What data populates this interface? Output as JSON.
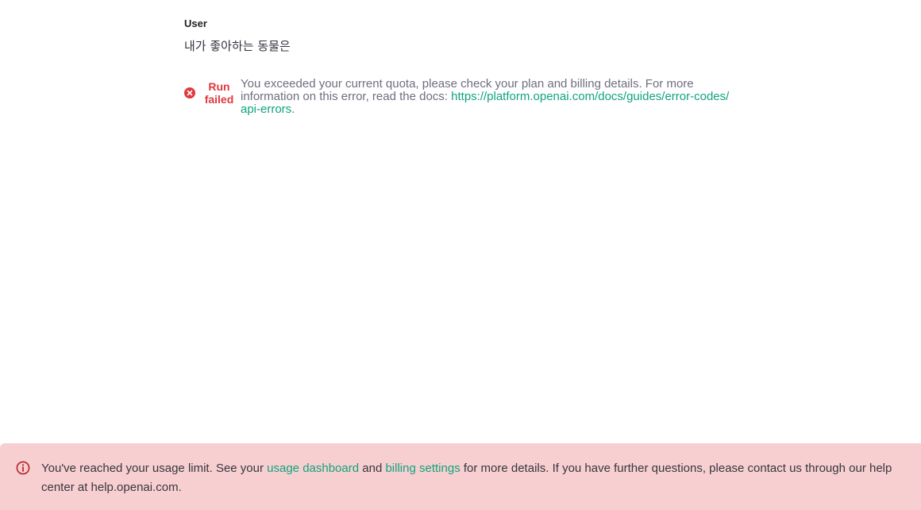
{
  "thread": {
    "role_label": "User",
    "user_message": "내가 좋아하는 동물은",
    "run": {
      "status_line1": "Run",
      "status_line2": "failed",
      "status_icon": "x-circle-icon",
      "error_prefix": "You exceeded your current quota, please check your plan and billing details. For more information on this error, read the docs: ",
      "error_link": "https://platform.openai.com/docs/guides/error-codes/api-errors",
      "error_suffix": "."
    }
  },
  "banner": {
    "icon": "info-circle-icon",
    "text_1": "You've reached your usage limit. See your ",
    "link_usage": "usage dashboard",
    "text_2": " and ",
    "link_billing": "billing settings",
    "text_3": " for more details. If you have further questions, please contact us through our help center at help.openai.com."
  },
  "colors": {
    "error_red": "#e0393e",
    "link_green": "#10a37f",
    "banner_bg": "#f8cfd0",
    "muted_text": "#6e6e80"
  }
}
